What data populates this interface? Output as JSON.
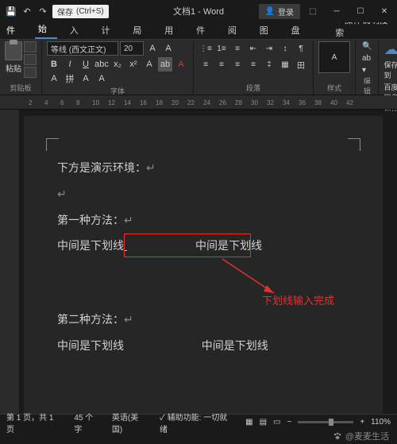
{
  "titlebar": {
    "save_label": "保存",
    "save_shortcut": "(Ctrl+S)",
    "doc_title": "文档1 - Word",
    "login": "登录"
  },
  "tabs": {
    "file": "文件",
    "home": "开始",
    "insert": "插入",
    "design": "设计",
    "layout": "布局",
    "references": "引用",
    "mailings": "邮件",
    "review": "审阅",
    "view": "视图",
    "baidu": "百度网盘",
    "tell_me": "操作说明搜索"
  },
  "ribbon": {
    "paste": "粘贴",
    "clipboard_label": "剪贴板",
    "font_name": "等线 (西文正文)",
    "font_size": "20",
    "font_label": "字体",
    "para_label": "段落",
    "styles_label": "样式",
    "edit_label": "编辑",
    "save_baidu_line1": "保存到",
    "save_baidu_line2": "百度网盘",
    "save_label": "保存"
  },
  "ruler": [
    "2",
    "4",
    "6",
    "8",
    "10",
    "12",
    "14",
    "16",
    "18",
    "20",
    "22",
    "24",
    "26",
    "28",
    "30",
    "32",
    "34",
    "36",
    "38",
    "40",
    "42"
  ],
  "doc": {
    "line1": "下方是演示环境：",
    "line2": "第一种方法：",
    "line3a": "中间是下划线",
    "line3b": "中间是下划线",
    "line4": "第二种方法：",
    "line5a": "中间是下划线",
    "line5b": "中间是下划线",
    "annotation": "下划线输入完成"
  },
  "status": {
    "page": "第 1 页，共 1 页",
    "words": "45 个字",
    "lang": "英语(美国)",
    "access": "辅助功能: 一切就绪",
    "zoom": "110%"
  },
  "watermark": "@麦麦生活"
}
